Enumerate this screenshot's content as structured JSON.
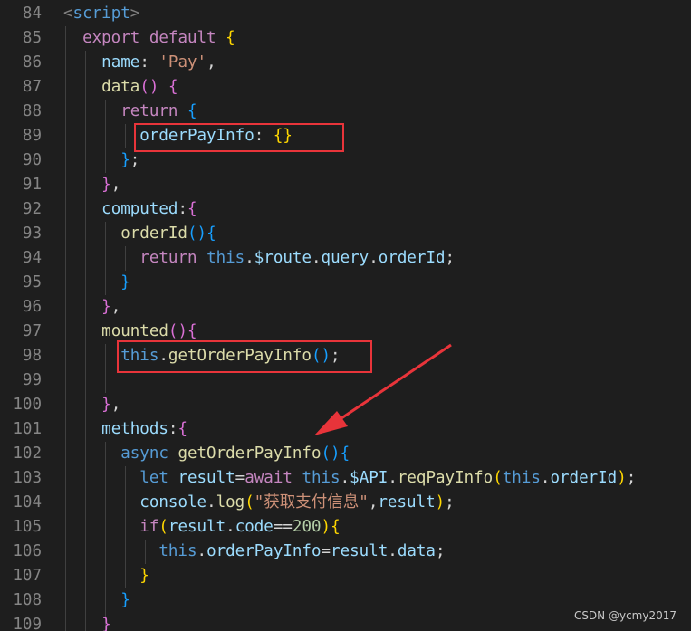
{
  "editor": {
    "lines": [
      {
        "no": "84",
        "tokens": [
          [
            "<",
            "tag"
          ],
          [
            "script",
            "kw"
          ],
          [
            ">",
            "tag"
          ]
        ]
      },
      {
        "no": "85",
        "tokens": [
          [
            "  ",
            ""
          ],
          [
            "export",
            "ctl"
          ],
          [
            " ",
            ""
          ],
          [
            "default",
            "ctl"
          ],
          [
            " ",
            ""
          ],
          [
            "{",
            "b1"
          ]
        ]
      },
      {
        "no": "86",
        "tokens": [
          [
            "    ",
            ""
          ],
          [
            "name",
            "prop"
          ],
          [
            ": ",
            ""
          ],
          [
            "'Pay'",
            "str"
          ],
          [
            ",",
            ""
          ]
        ]
      },
      {
        "no": "87",
        "tokens": [
          [
            "    ",
            ""
          ],
          [
            "data",
            "fn"
          ],
          [
            "()",
            "b2"
          ],
          [
            " ",
            ""
          ],
          [
            "{",
            "b2"
          ]
        ]
      },
      {
        "no": "88",
        "tokens": [
          [
            "      ",
            ""
          ],
          [
            "return",
            "ctl"
          ],
          [
            " ",
            ""
          ],
          [
            "{",
            "b3"
          ]
        ]
      },
      {
        "no": "89",
        "tokens": [
          [
            "        ",
            ""
          ],
          [
            "orderPayInfo",
            "prop"
          ],
          [
            ": ",
            ""
          ],
          [
            "{}",
            "b1"
          ]
        ]
      },
      {
        "no": "90",
        "tokens": [
          [
            "      ",
            ""
          ],
          [
            "}",
            "b3"
          ],
          [
            ";",
            ""
          ]
        ]
      },
      {
        "no": "91",
        "tokens": [
          [
            "    ",
            ""
          ],
          [
            "}",
            "b2"
          ],
          [
            ",",
            ""
          ]
        ]
      },
      {
        "no": "92",
        "tokens": [
          [
            "    ",
            ""
          ],
          [
            "computed",
            "prop"
          ],
          [
            ":",
            ""
          ],
          [
            "{",
            "b2"
          ]
        ]
      },
      {
        "no": "93",
        "tokens": [
          [
            "      ",
            ""
          ],
          [
            "orderId",
            "fn"
          ],
          [
            "()",
            "b3"
          ],
          [
            "{",
            "b3"
          ]
        ]
      },
      {
        "no": "94",
        "tokens": [
          [
            "        ",
            ""
          ],
          [
            "return",
            "ctl"
          ],
          [
            " ",
            ""
          ],
          [
            "this",
            "kw"
          ],
          [
            ".",
            ""
          ],
          [
            "$route",
            "prop"
          ],
          [
            ".",
            ""
          ],
          [
            "query",
            "prop"
          ],
          [
            ".",
            ""
          ],
          [
            "orderId",
            "prop"
          ],
          [
            ";",
            ""
          ]
        ]
      },
      {
        "no": "95",
        "tokens": [
          [
            "      ",
            ""
          ],
          [
            "}",
            "b3"
          ]
        ]
      },
      {
        "no": "96",
        "tokens": [
          [
            "    ",
            ""
          ],
          [
            "}",
            "b2"
          ],
          [
            ",",
            ""
          ]
        ]
      },
      {
        "no": "97",
        "tokens": [
          [
            "    ",
            ""
          ],
          [
            "mounted",
            "fn"
          ],
          [
            "()",
            "b2"
          ],
          [
            "{",
            "b2"
          ]
        ]
      },
      {
        "no": "98",
        "tokens": [
          [
            "      ",
            ""
          ],
          [
            "this",
            "kw"
          ],
          [
            ".",
            ""
          ],
          [
            "getOrderPayInfo",
            "fn"
          ],
          [
            "()",
            "b3"
          ],
          [
            ";",
            ""
          ]
        ]
      },
      {
        "no": "99",
        "tokens": []
      },
      {
        "no": "100",
        "tokens": [
          [
            "    ",
            ""
          ],
          [
            "}",
            "b2"
          ],
          [
            ",",
            ""
          ]
        ]
      },
      {
        "no": "101",
        "tokens": [
          [
            "    ",
            ""
          ],
          [
            "methods",
            "prop"
          ],
          [
            ":",
            ""
          ],
          [
            "{",
            "b2"
          ]
        ]
      },
      {
        "no": "102",
        "tokens": [
          [
            "      ",
            ""
          ],
          [
            "async",
            "kw"
          ],
          [
            " ",
            ""
          ],
          [
            "getOrderPayInfo",
            "fn"
          ],
          [
            "()",
            "b3"
          ],
          [
            "{",
            "b3"
          ]
        ]
      },
      {
        "no": "103",
        "tokens": [
          [
            "        ",
            ""
          ],
          [
            "let",
            "kw"
          ],
          [
            " ",
            ""
          ],
          [
            "result",
            "prop"
          ],
          [
            "=",
            ""
          ],
          [
            "await",
            "ctl"
          ],
          [
            " ",
            ""
          ],
          [
            "this",
            "kw"
          ],
          [
            ".",
            ""
          ],
          [
            "$API",
            "prop"
          ],
          [
            ".",
            ""
          ],
          [
            "reqPayInfo",
            "fn"
          ],
          [
            "(",
            "b1"
          ],
          [
            "this",
            "kw"
          ],
          [
            ".",
            ""
          ],
          [
            "orderId",
            "prop"
          ],
          [
            ")",
            "b1"
          ],
          [
            ";",
            ""
          ]
        ]
      },
      {
        "no": "104",
        "tokens": [
          [
            "        ",
            ""
          ],
          [
            "console",
            "prop"
          ],
          [
            ".",
            ""
          ],
          [
            "log",
            "fn"
          ],
          [
            "(",
            "b1"
          ],
          [
            "\"获取支付信息\"",
            "str"
          ],
          [
            ",",
            ""
          ],
          [
            "result",
            "prop"
          ],
          [
            ")",
            "b1"
          ],
          [
            ";",
            ""
          ]
        ]
      },
      {
        "no": "105",
        "tokens": [
          [
            "        ",
            ""
          ],
          [
            "if",
            "ctl"
          ],
          [
            "(",
            "b1"
          ],
          [
            "result",
            "prop"
          ],
          [
            ".",
            ""
          ],
          [
            "code",
            "prop"
          ],
          [
            "==",
            ""
          ],
          [
            "200",
            "num"
          ],
          [
            ")",
            "b1"
          ],
          [
            "{",
            "b1"
          ]
        ]
      },
      {
        "no": "106",
        "tokens": [
          [
            "          ",
            ""
          ],
          [
            "this",
            "kw"
          ],
          [
            ".",
            ""
          ],
          [
            "orderPayInfo",
            "prop"
          ],
          [
            "=",
            ""
          ],
          [
            "result",
            "prop"
          ],
          [
            ".",
            ""
          ],
          [
            "data",
            "prop"
          ],
          [
            ";",
            ""
          ]
        ]
      },
      {
        "no": "107",
        "tokens": [
          [
            "        ",
            ""
          ],
          [
            "}",
            "b1"
          ]
        ]
      },
      {
        "no": "108",
        "tokens": [
          [
            "      ",
            ""
          ],
          [
            "}",
            "b3"
          ]
        ]
      },
      {
        "no": "109",
        "tokens": [
          [
            "    ",
            ""
          ],
          [
            "}",
            "b2"
          ]
        ]
      }
    ]
  },
  "watermark": "CSDN @ycmy2017",
  "colors": {
    "background": "#1e1e1e",
    "highlight_box": "#e8343a",
    "arrow": "#e8343a"
  }
}
